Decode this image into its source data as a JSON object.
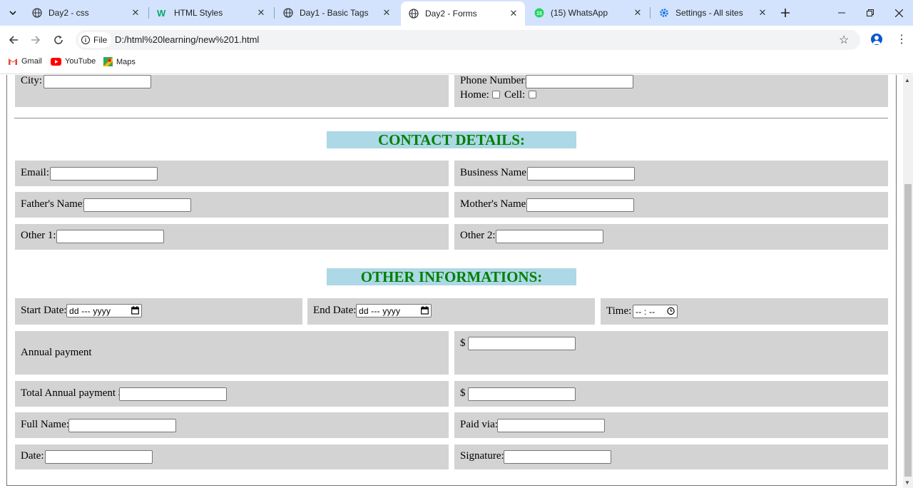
{
  "browser": {
    "tabs": [
      {
        "title": "Day2 - css",
        "icon": "globe-icon"
      },
      {
        "title": "HTML Styles",
        "icon": "w3schools-icon"
      },
      {
        "title": "Day1 - Basic Tags",
        "icon": "globe-icon"
      },
      {
        "title": "Day2 - Forms",
        "icon": "globe-icon",
        "active": true
      },
      {
        "title": "(15) WhatsApp",
        "icon": "whatsapp-icon",
        "badge": "15"
      },
      {
        "title": "Settings - All sites",
        "icon": "gear-icon"
      }
    ],
    "chip_label": "File",
    "url": "D:/html%20learning/new%201.html",
    "bookmarks": [
      {
        "label": "Gmail",
        "icon": "gmail-icon"
      },
      {
        "label": "YouTube",
        "icon": "youtube-icon"
      },
      {
        "label": "Maps",
        "icon": "maps-icon"
      }
    ]
  },
  "form": {
    "address": {
      "city_label": "City:",
      "phone_label": "Phone Number:",
      "home_label": "Home:",
      "cell_label": "Cell:"
    },
    "contact": {
      "heading": "CONTACT DETAILS:",
      "email_label": "Email:",
      "business_label": "Business Name:",
      "father_label": "Father's Name:",
      "mother_label": "Mother's Name:",
      "other1_label": "Other 1:",
      "other2_label": "Other 2:"
    },
    "other": {
      "heading": "OTHER INFORMATIONS:",
      "start_label": "Start Date:",
      "end_label": "End Date:",
      "time_label": "Time:",
      "date_placeholder": "dd --- yyyy",
      "time_placeholder": "-- : --",
      "annual_label": "Annual payment",
      "dollar": "$",
      "total_label": "Total Annual payment $",
      "fullname_label": "Full Name:",
      "paidvia_label": "Paid via:",
      "date_label": "Date:",
      "signature_label": "Signature:"
    }
  },
  "colors": {
    "tabstrip": "#d3e3fd",
    "row_bg": "#d3d3d3",
    "heading_bg": "#add8e6",
    "heading_text": "#008000"
  }
}
